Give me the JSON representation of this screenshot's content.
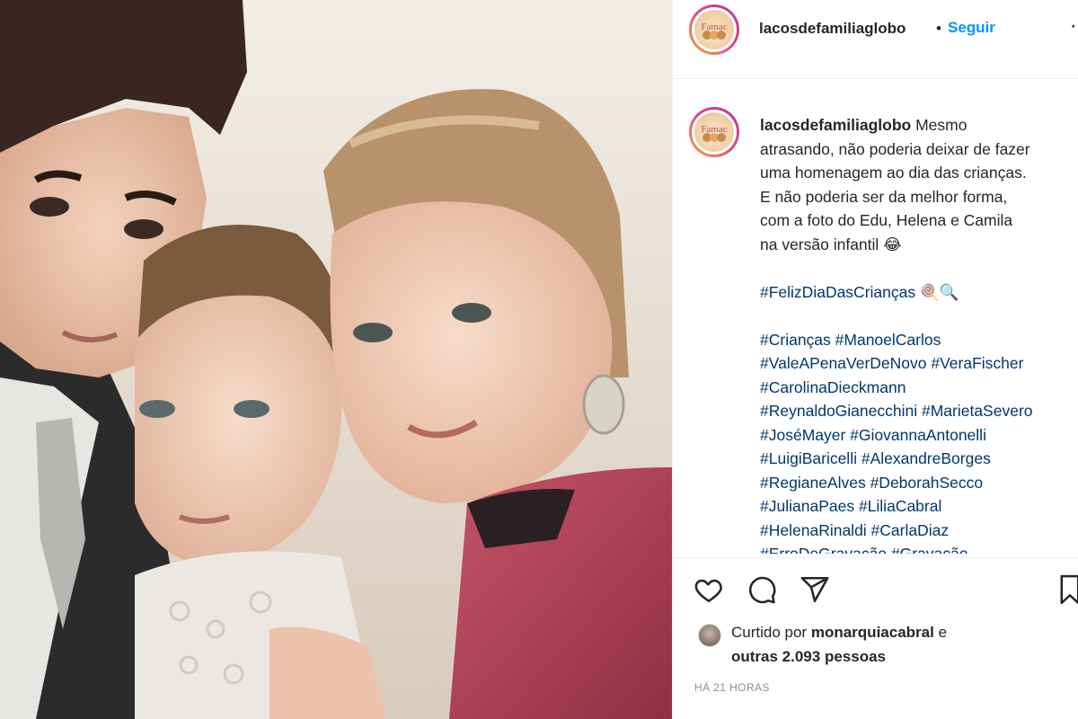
{
  "post": {
    "username": "lacosdefamiliaglobo",
    "separator": "•",
    "follow_label": "Seguir",
    "more_icon": "more-icon",
    "logo_text": "Famac"
  },
  "caption": {
    "username": "lacosdefamiliaglobo",
    "lines": [
      "Mesmo",
      "atrasando, não poderia deixar de fazer",
      "uma homenagem ao dia das crianças.",
      "E não poderia ser da melhor forma,",
      "com a foto do Edu, Helena e Camila",
      "na versão infantil 😂"
    ],
    "hashtag_line": "#FelizDiaDasCrianças",
    "hashtag_emoji": "🍭🔍",
    "tag_lines": [
      "#Crianças #ManoelCarlos",
      "#ValeAPenaVerDeNovo #VeraFischer",
      "#CarolinaDieckmann",
      "#ReynaldoGianecchini #MarietaSevero",
      "#JoséMayer #GiovannaAntonelli",
      "#LuigiBaricelli #AlexandreBorges",
      "#RegianeAlves #DeborahSecco",
      "#JulianaPaes #LiliaCabral",
      "#HelenaRinaldi #CarlaDiaz",
      "#ErroDeGravação #Gravação"
    ]
  },
  "actions": {
    "like_icon": "heart-icon",
    "comment_icon": "comment-icon",
    "share_icon": "paper-plane-icon",
    "save_icon": "bookmark-icon"
  },
  "likes": {
    "prefix": "Curtido por",
    "liker": "monarquiacabral",
    "conjunction": "e",
    "others": "outras 2.093 pessoas"
  },
  "timestamp": "HÁ 21 HORAS",
  "colors": {
    "accent": "#0095f6",
    "hashtag": "#00376b",
    "text": "#262626",
    "muted": "#8e8e8e"
  }
}
